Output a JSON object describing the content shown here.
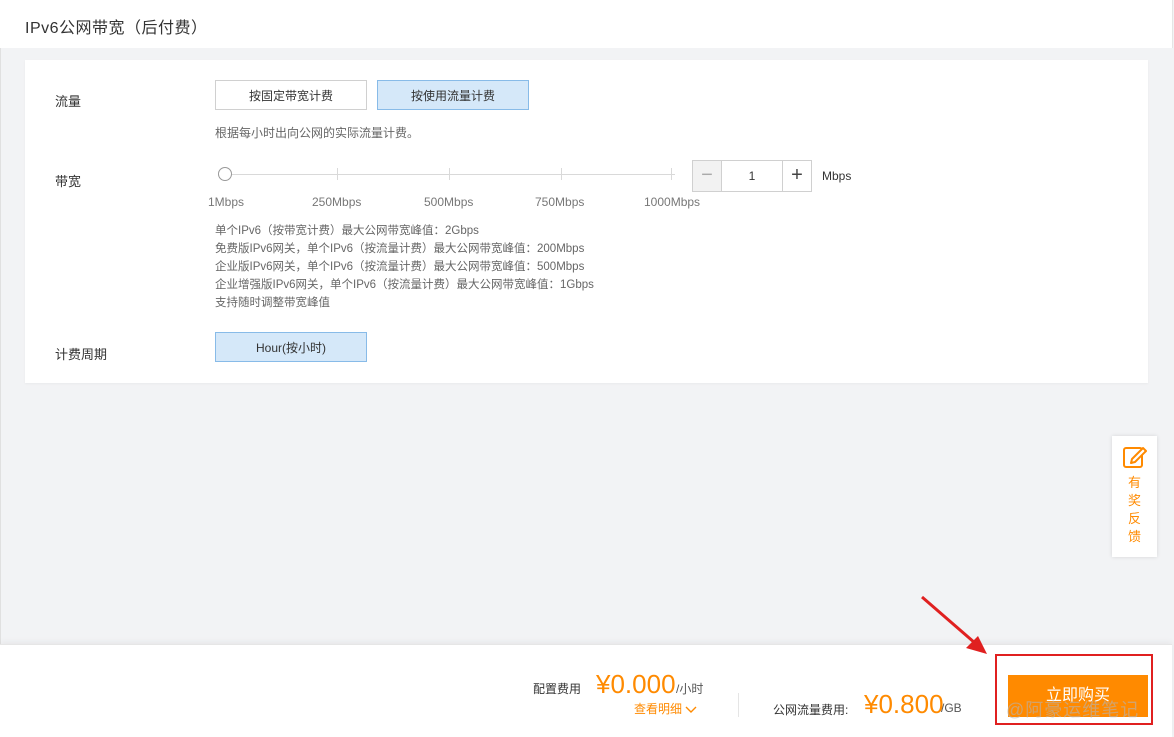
{
  "header": {
    "title": "IPv6公网带宽（后付费）"
  },
  "traffic": {
    "label": "流量",
    "options": [
      "按固定带宽计费",
      "按使用流量计费"
    ],
    "selected_index": 1,
    "hint": "根据每小时出向公网的实际流量计费。"
  },
  "bandwidth": {
    "label": "带宽",
    "ticks": [
      "1Mbps",
      "250Mbps",
      "500Mbps",
      "750Mbps",
      "1000Mbps"
    ],
    "value": "1",
    "unit": "Mbps",
    "stepper_minus": "−",
    "stepper_plus": "+",
    "limits": [
      "单个IPv6（按带宽计费）最大公网带宽峰值：2Gbps",
      "免费版IPv6网关，单个IPv6（按流量计费）最大公网带宽峰值：200Mbps",
      "企业版IPv6网关，单个IPv6（按流量计费）最大公网带宽峰值：500Mbps",
      "企业增强版IPv6网关，单个IPv6（按流量计费）最大公网带宽峰值：1Gbps",
      "支持随时调整带宽峰值"
    ]
  },
  "billing": {
    "label": "计费周期",
    "option": "Hour(按小时)"
  },
  "feedback": {
    "chars": [
      "有",
      "奖",
      "反",
      "馈"
    ],
    "icon": "edit-icon"
  },
  "footer": {
    "config_fee_label": "配置费用",
    "config_fee_value": "¥0.000",
    "config_fee_unit": "/小时",
    "details_label": "查看明细",
    "traffic_fee_label": "公网流量费用:",
    "traffic_fee_value": "¥0.800",
    "traffic_fee_unit": "/GB",
    "buy_label": "立即购买"
  },
  "watermark": "@阿豪运维笔记",
  "colors": {
    "accent": "#ff8a00",
    "selected_bg": "#d5e8f9",
    "annotation": "#e02020"
  }
}
